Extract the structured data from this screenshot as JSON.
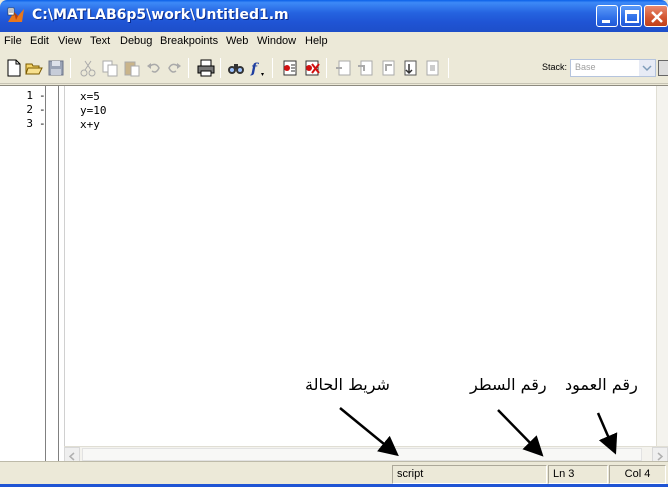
{
  "window": {
    "title": "C:\\MATLAB6p5\\work\\Untitled1.m"
  },
  "menu": [
    {
      "label": "File"
    },
    {
      "label": "Edit"
    },
    {
      "label": "View"
    },
    {
      "label": "Text"
    },
    {
      "label": "Debug"
    },
    {
      "label": "Breakpoints"
    },
    {
      "label": "Web"
    },
    {
      "label": "Window"
    },
    {
      "label": "Help"
    }
  ],
  "toolbar": {
    "icons": [
      "new-file-icon",
      "open-folder-icon",
      "save-icon",
      "cut-icon",
      "copy-icon",
      "paste-icon",
      "undo-icon",
      "redo-icon",
      "print-icon",
      "find-icon",
      "function-icon",
      "set-breakpoint-icon",
      "clear-breakpoints-icon",
      "step-icon",
      "step-in-icon",
      "step-out-icon",
      "continue-icon",
      "exit-debug-icon"
    ],
    "stack_label": "Stack:",
    "stack_value": "Base"
  },
  "editor": {
    "lines": [
      {
        "num": "1",
        "marker": "-",
        "code": "x=5"
      },
      {
        "num": "2",
        "marker": "-",
        "code": "y=10"
      },
      {
        "num": "3",
        "marker": "-",
        "code": "x+y"
      }
    ]
  },
  "annotations": {
    "status_bar": "شريط الحالة",
    "line_number": "رقم السطر",
    "column_number": "رقم العمود"
  },
  "status": {
    "mode": "script",
    "line": "Ln 3",
    "col": "Col 4"
  },
  "colors": {
    "titlebar": "#1f54d4",
    "chrome": "#ece9d8",
    "close_button": "#d2542f"
  }
}
